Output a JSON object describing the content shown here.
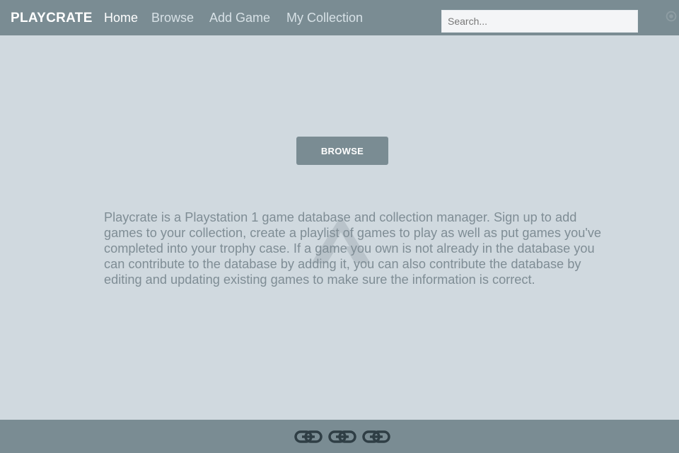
{
  "header": {
    "brand": "PLAYCRATE",
    "nav": [
      {
        "label": "Home",
        "active": true
      },
      {
        "label": "Browse",
        "active": false
      },
      {
        "label": "Add Game",
        "active": false
      },
      {
        "label": "My Collection",
        "active": false
      }
    ],
    "search": {
      "placeholder": "Search...",
      "value": ""
    },
    "settings_icon": "gear-icon"
  },
  "main": {
    "browse_label": "BROWSE",
    "description": "Playcrate is a Playstation 1 game database and collection manager. Sign up to add games to your collection, create a playlist of games to play as well as put games you've completed into your trophy case. If a game you own is not already in the database you can contribute to the database by adding it, you can also contribute the database by editing and updating existing games to make sure the information is correct.",
    "watermark_icon": "logo-watermark-icon"
  },
  "footer": {
    "links": [
      {
        "icon": "link-icon"
      },
      {
        "icon": "link-icon"
      },
      {
        "icon": "link-icon"
      }
    ]
  },
  "colors": {
    "navbar": "#7a8c93",
    "background": "#d0d9df",
    "text_muted": "#7f8d95",
    "link_icon": "#2f3e45"
  }
}
